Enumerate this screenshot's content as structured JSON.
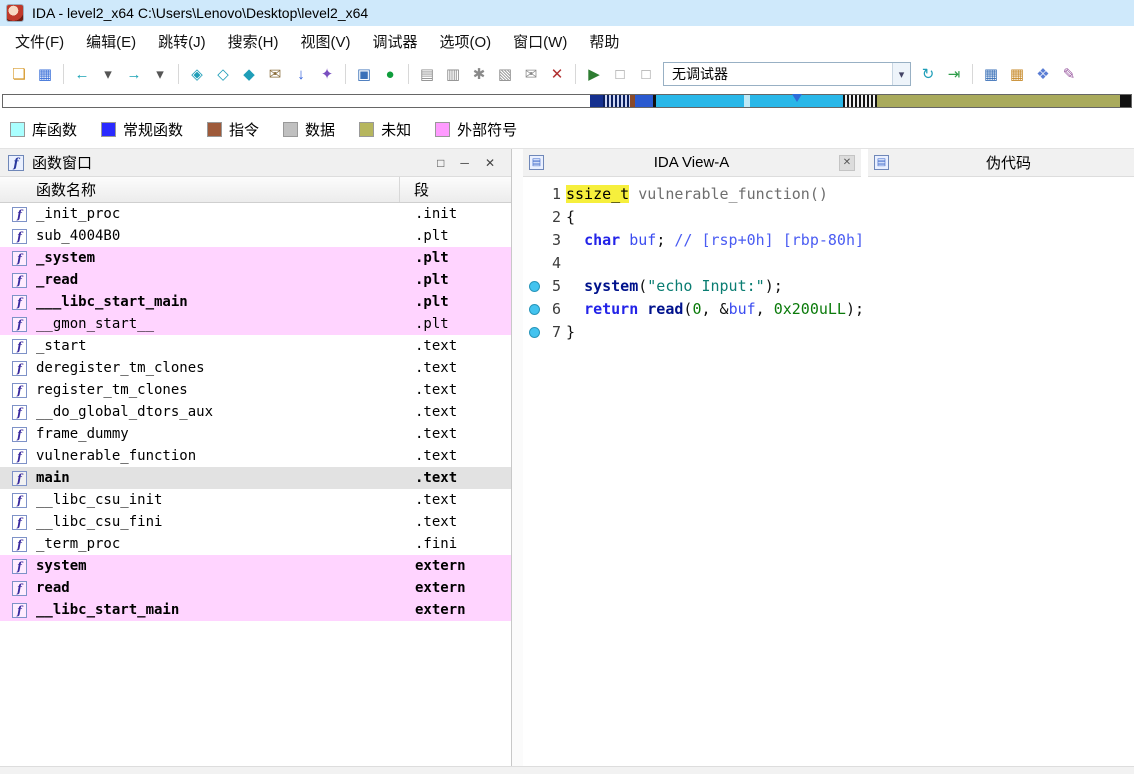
{
  "window": {
    "title": "IDA - level2_x64 C:\\Users\\Lenovo\\Desktop\\level2_x64"
  },
  "menu": {
    "items": [
      {
        "key": "file",
        "label": "文件(F)"
      },
      {
        "key": "edit",
        "label": "编辑(E)"
      },
      {
        "key": "jump",
        "label": "跳转(J)"
      },
      {
        "key": "search",
        "label": "搜索(H)"
      },
      {
        "key": "view",
        "label": "视图(V)"
      },
      {
        "key": "debugger",
        "label": "调试器"
      },
      {
        "key": "options",
        "label": "选项(O)"
      },
      {
        "key": "windows",
        "label": "窗口(W)"
      },
      {
        "key": "help",
        "label": "帮助"
      }
    ]
  },
  "toolbar": {
    "debugger_combo": "无调试器",
    "items": [
      {
        "type": "icon",
        "name": "open-file-icon",
        "glyph": "❏",
        "color": "#d79b2f"
      },
      {
        "type": "icon",
        "name": "save-icon",
        "glyph": "▦",
        "color": "#3a6fd8"
      },
      {
        "type": "sep"
      },
      {
        "type": "icon",
        "name": "nav-back-icon",
        "glyph": "←",
        "color": "#19a3b5"
      },
      {
        "type": "icon",
        "name": "nav-back-menu-icon",
        "glyph": "▾",
        "color": "#555555"
      },
      {
        "type": "icon",
        "name": "nav-forward-icon",
        "glyph": "→",
        "color": "#19a3b5"
      },
      {
        "type": "icon",
        "name": "nav-forward-menu-icon",
        "glyph": "▾",
        "color": "#555555"
      },
      {
        "type": "sep"
      },
      {
        "type": "icon",
        "name": "jump-name-icon",
        "glyph": "◈",
        "color": "#1f9eb8"
      },
      {
        "type": "icon",
        "name": "jump-segment-icon",
        "glyph": "◇",
        "color": "#1f9eb8"
      },
      {
        "type": "icon",
        "name": "jump-problem-icon",
        "glyph": "◆",
        "color": "#1f9eb8"
      },
      {
        "type": "icon",
        "name": "mail-icon",
        "glyph": "✉",
        "color": "#8a6d3b"
      },
      {
        "type": "icon",
        "name": "jump-next-icon",
        "glyph": "↓",
        "color": "#2b5cd9"
      },
      {
        "type": "icon",
        "name": "script-icon",
        "glyph": "✦",
        "color": "#7a4fc0"
      },
      {
        "type": "sep"
      },
      {
        "type": "icon",
        "name": "text-view-icon",
        "glyph": "▣",
        "color": "#3b71b8"
      },
      {
        "type": "icon",
        "name": "graph-overview-icon",
        "glyph": "●",
        "color": "#0f9d3c"
      },
      {
        "type": "sep"
      },
      {
        "type": "icon",
        "name": "structures-icon",
        "glyph": "▤",
        "color": "#8a8a8a"
      },
      {
        "type": "icon",
        "name": "enums-icon",
        "glyph": "▥",
        "color": "#8a8a8a"
      },
      {
        "type": "icon",
        "name": "cross-references-icon",
        "glyph": "✱",
        "color": "#8a8a8a"
      },
      {
        "type": "icon",
        "name": "segments-icon",
        "glyph": "▧",
        "color": "#8a8a8a"
      },
      {
        "type": "icon",
        "name": "notes-icon",
        "glyph": "✉",
        "color": "#8a8a8a"
      },
      {
        "type": "icon",
        "name": "close-window-icon",
        "glyph": "✕",
        "color": "#b03030"
      },
      {
        "type": "sep"
      },
      {
        "type": "icon",
        "name": "debug-start-icon",
        "glyph": "▶",
        "color": "#2e7d32"
      },
      {
        "type": "icon",
        "name": "debug-pause-icon",
        "glyph": "□",
        "color": "#9a9a9a"
      },
      {
        "type": "icon",
        "name": "debug-stop-icon",
        "glyph": "□",
        "color": "#9a9a9a"
      },
      {
        "type": "combo",
        "name": "debugger-selector"
      },
      {
        "type": "icon",
        "name": "debugger-attach-icon",
        "glyph": "↻",
        "color": "#1f9eb8"
      },
      {
        "type": "icon",
        "name": "debugger-step-icon",
        "glyph": "⇥",
        "color": "#2e9d4a"
      },
      {
        "type": "sep"
      },
      {
        "type": "icon",
        "name": "breakpoint-list-icon",
        "glyph": "▦",
        "color": "#3b71b8"
      },
      {
        "type": "icon",
        "name": "module-list-icon",
        "glyph": "▦",
        "color": "#c78a2a"
      },
      {
        "type": "icon",
        "name": "plugins-icon",
        "glyph": "❖",
        "color": "#5a7dd4"
      },
      {
        "type": "icon",
        "name": "edit-icon",
        "glyph": "✎",
        "color": "#9a5aa0"
      }
    ]
  },
  "navband": {
    "pointer_pct": 70.3,
    "segments": [
      {
        "color": "#ffffff",
        "w": 52.0
      },
      {
        "color": "#15308f",
        "w": 1.2
      },
      {
        "stripe": "stripe-dark",
        "w": 2.4
      },
      {
        "color": "#8a4a2a",
        "w": 0.4
      },
      {
        "color": "#2a5ad0",
        "w": 1.6
      },
      {
        "color": "#111111",
        "w": 0.3
      },
      {
        "color": "#29b7e8",
        "w": 7.8
      },
      {
        "color": "#bfe9f6",
        "w": 0.5
      },
      {
        "color": "#29b7e8",
        "w": 8.3
      },
      {
        "stripe": "stripe-bw",
        "w": 3.0
      },
      {
        "color": "#a9aa5c",
        "w": 21.5
      },
      {
        "color": "#111111",
        "w": 1.0
      }
    ]
  },
  "legend": {
    "items": [
      {
        "key": "library-function",
        "label": "库函数",
        "color": "#aaffff"
      },
      {
        "key": "regular-function",
        "label": "常规函数",
        "color": "#2a2aff"
      },
      {
        "key": "instruction",
        "label": "指令",
        "color": "#9e5a3a"
      },
      {
        "key": "data",
        "label": "数据",
        "color": "#c0c0c0"
      },
      {
        "key": "unknown",
        "label": "未知",
        "color": "#b6b65e"
      },
      {
        "key": "external-symbol",
        "label": "外部符号",
        "color": "#ff9bff"
      }
    ]
  },
  "functions_panel": {
    "title": "函数窗口",
    "columns": [
      "函数名称",
      "段"
    ],
    "rows": [
      {
        "name": "_init_proc",
        "seg": ".init",
        "bg": "white",
        "bold": false
      },
      {
        "name": "sub_4004B0",
        "seg": ".plt",
        "bg": "white",
        "bold": false
      },
      {
        "name": "_system",
        "seg": ".plt",
        "bg": "pink",
        "bold": true
      },
      {
        "name": "_read",
        "seg": ".plt",
        "bg": "pink",
        "bold": true
      },
      {
        "name": "___libc_start_main",
        "seg": ".plt",
        "bg": "pink",
        "bold": true
      },
      {
        "name": "__gmon_start__",
        "seg": ".plt",
        "bg": "pink",
        "bold": false
      },
      {
        "name": "_start",
        "seg": ".text",
        "bg": "white",
        "bold": false
      },
      {
        "name": "deregister_tm_clones",
        "seg": ".text",
        "bg": "white",
        "bold": false
      },
      {
        "name": "register_tm_clones",
        "seg": ".text",
        "bg": "white",
        "bold": false
      },
      {
        "name": "__do_global_dtors_aux",
        "seg": ".text",
        "bg": "white",
        "bold": false
      },
      {
        "name": "frame_dummy",
        "seg": ".text",
        "bg": "white",
        "bold": false
      },
      {
        "name": "vulnerable_function",
        "seg": ".text",
        "bg": "white",
        "bold": false
      },
      {
        "name": "main",
        "seg": ".text",
        "bg": "sel",
        "bold": true
      },
      {
        "name": "__libc_csu_init",
        "seg": ".text",
        "bg": "white",
        "bold": false
      },
      {
        "name": "__libc_csu_fini",
        "seg": ".text",
        "bg": "white",
        "bold": false
      },
      {
        "name": "_term_proc",
        "seg": ".fini",
        "bg": "white",
        "bold": false
      },
      {
        "name": "system",
        "seg": "extern",
        "bg": "pink",
        "bold": true
      },
      {
        "name": "read",
        "seg": "extern",
        "bg": "pink",
        "bold": true
      },
      {
        "name": "__libc_start_main",
        "seg": "extern",
        "bg": "pink",
        "bold": true
      }
    ]
  },
  "right_panel": {
    "tabs": [
      {
        "label": "IDA View-A"
      },
      {
        "label": "伪代码"
      }
    ]
  },
  "code": {
    "lines": [
      {
        "num": 1,
        "dot": false,
        "tokens": [
          {
            "t": "ssize_t",
            "c": "hl"
          },
          {
            "t": " ",
            "c": "plain"
          },
          {
            "t": "vulnerable_function()",
            "c": "gray"
          }
        ]
      },
      {
        "num": 2,
        "dot": false,
        "tokens": [
          {
            "t": "{",
            "c": "plain"
          }
        ]
      },
      {
        "num": 3,
        "dot": false,
        "tokens": [
          {
            "t": "  ",
            "c": "plain"
          },
          {
            "t": "char",
            "c": "kw"
          },
          {
            "t": " ",
            "c": "plain"
          },
          {
            "t": "buf",
            "c": "var"
          },
          {
            "t": "; ",
            "c": "plain"
          },
          {
            "t": "// [rsp+0h] [rbp-80h]",
            "c": "cmt"
          }
        ]
      },
      {
        "num": 4,
        "dot": false,
        "tokens": []
      },
      {
        "num": 5,
        "dot": true,
        "tokens": [
          {
            "t": "  ",
            "c": "plain"
          },
          {
            "t": "system",
            "c": "func"
          },
          {
            "t": "(",
            "c": "plain"
          },
          {
            "t": "\"echo Input:\"",
            "c": "str"
          },
          {
            "t": ");",
            "c": "plain"
          }
        ]
      },
      {
        "num": 6,
        "dot": true,
        "tokens": [
          {
            "t": "  ",
            "c": "plain"
          },
          {
            "t": "return",
            "c": "kw"
          },
          {
            "t": " ",
            "c": "plain"
          },
          {
            "t": "read",
            "c": "func"
          },
          {
            "t": "(",
            "c": "plain"
          },
          {
            "t": "0",
            "c": "num"
          },
          {
            "t": ", &",
            "c": "plain"
          },
          {
            "t": "buf",
            "c": "var"
          },
          {
            "t": ", ",
            "c": "plain"
          },
          {
            "t": "0x200uLL",
            "c": "num"
          },
          {
            "t": ");",
            "c": "plain"
          }
        ]
      },
      {
        "num": 7,
        "dot": true,
        "tokens": [
          {
            "t": "}",
            "c": "plain"
          }
        ]
      }
    ]
  }
}
